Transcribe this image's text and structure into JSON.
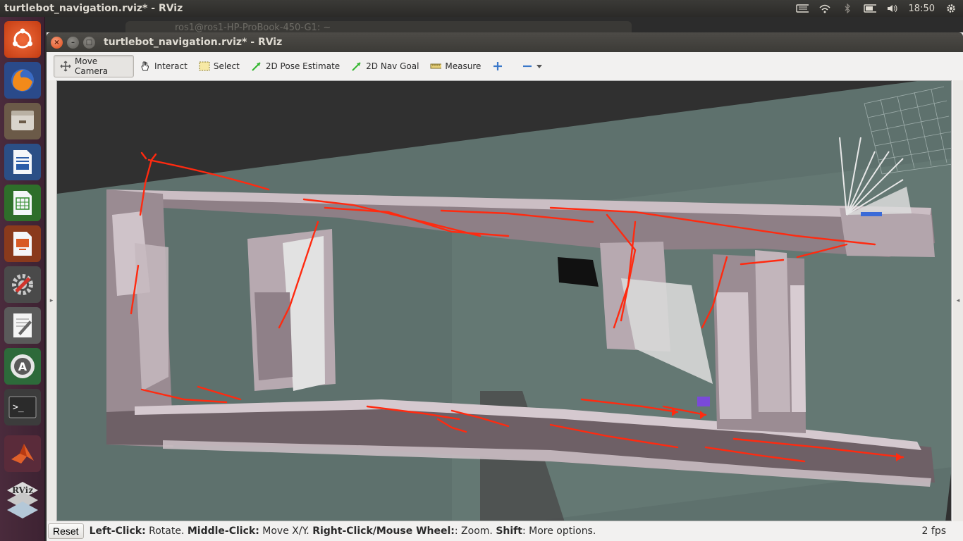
{
  "top_panel": {
    "title": "turtlebot_navigation.rviz* - RViz",
    "clock": "18:50"
  },
  "background_window": {
    "title": "ros1@ros1-HP-ProBook-450-G1: ~"
  },
  "window": {
    "title": "turtlebot_navigation.rviz* - RViz"
  },
  "toolbar": {
    "move_camera": "Move Camera",
    "interact": "Interact",
    "select": "Select",
    "pose_estimate": "2D Pose Estimate",
    "nav_goal": "2D Nav Goal",
    "measure": "Measure"
  },
  "status": {
    "reset": "Reset",
    "left_click_key": "Left-Click:",
    "left_click_val": " Rotate. ",
    "middle_click_key": "Middle-Click:",
    "middle_click_val": " Move X/Y. ",
    "right_click_key": "Right-Click/Mouse Wheel:",
    "right_click_val": ": Zoom. ",
    "shift_key": "Shift",
    "shift_val": ": More options.",
    "fps": "2 fps"
  },
  "launcher": [
    "ubuntu-dash-icon",
    "firefox-icon",
    "files-icon",
    "writer-icon",
    "calc-icon",
    "impress-icon",
    "system-settings-icon",
    "text-editor-icon",
    "software-updater-icon",
    "terminal-icon",
    "matlab-icon",
    "rviz-icon"
  ],
  "colors": {
    "path_red": "#ff2a10",
    "floor": "#5e716d",
    "wall": "#b7a9b0"
  }
}
